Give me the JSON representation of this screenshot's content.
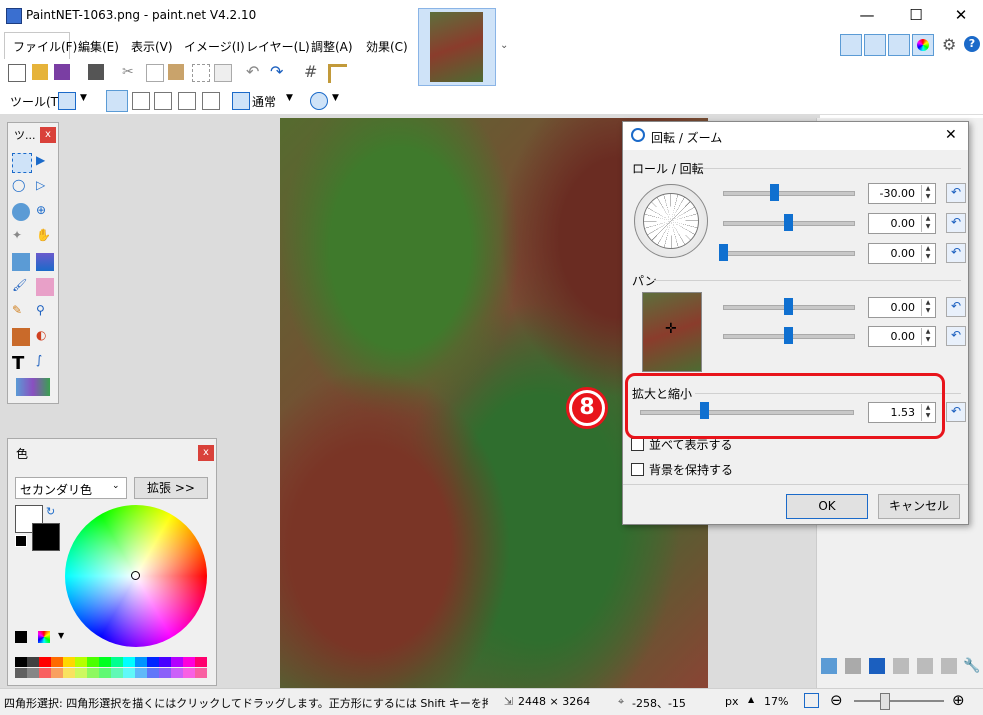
{
  "window": {
    "title": "PaintNET-1063.png - paint.net V4.2.10",
    "minimize": "—",
    "maximize": "☐",
    "close": "✕"
  },
  "menu": [
    "ファイル(F)",
    "編集(E)",
    "表示(V)",
    "イメージ(I)",
    "レイヤー(L)",
    "調整(A)",
    "効果(C)"
  ],
  "toolbar2": {
    "tool_label": "ツール(T):",
    "blend_mode": "通常"
  },
  "tools_panel": {
    "title": "ツ...",
    "close": "x"
  },
  "colors_panel": {
    "title": "色",
    "close": "x",
    "select_value": "セカンダリ色",
    "expand_button": "拡張 >>",
    "palette": [
      "#000000",
      "#404040",
      "#ff0000",
      "#ff6a00",
      "#ffd800",
      "#b6ff00",
      "#4cff00",
      "#00ff21",
      "#00ff90",
      "#00ffff",
      "#0094ff",
      "#0026ff",
      "#4800ff",
      "#b200ff",
      "#ff00dc",
      "#ff006e"
    ]
  },
  "dialog": {
    "title": "回転 / ズーム",
    "close": "✕",
    "roll_section": "ロール / 回転",
    "roll_values": [
      "-30.00",
      "0.00",
      "0.00"
    ],
    "roll_fractions": [
      0.39,
      0.5,
      0.0
    ],
    "pan_section": "パン",
    "pan_values": [
      "0.00",
      "0.00"
    ],
    "pan_fractions": [
      0.5,
      0.5
    ],
    "zoom_section": "拡大と縮小",
    "zoom_value": "1.53",
    "zoom_fraction": 0.3,
    "tile_checkbox": "並べて表示する",
    "keep_bg_checkbox": "背景を保持する",
    "ok": "OK",
    "cancel": "キャンセル",
    "reset_symbol": "↶"
  },
  "annotation": {
    "step_number": "8",
    "highlight_color": "#e8141b"
  },
  "status": {
    "hint": "四角形選択: 四角形選択を描くにはクリックしてドラッグします。正方形にするには Shift キーを押しながら操作します。",
    "image_size": "2448 × 3264",
    "cursor_pos": "-258、-15",
    "units": "px",
    "zoom": "17%"
  }
}
